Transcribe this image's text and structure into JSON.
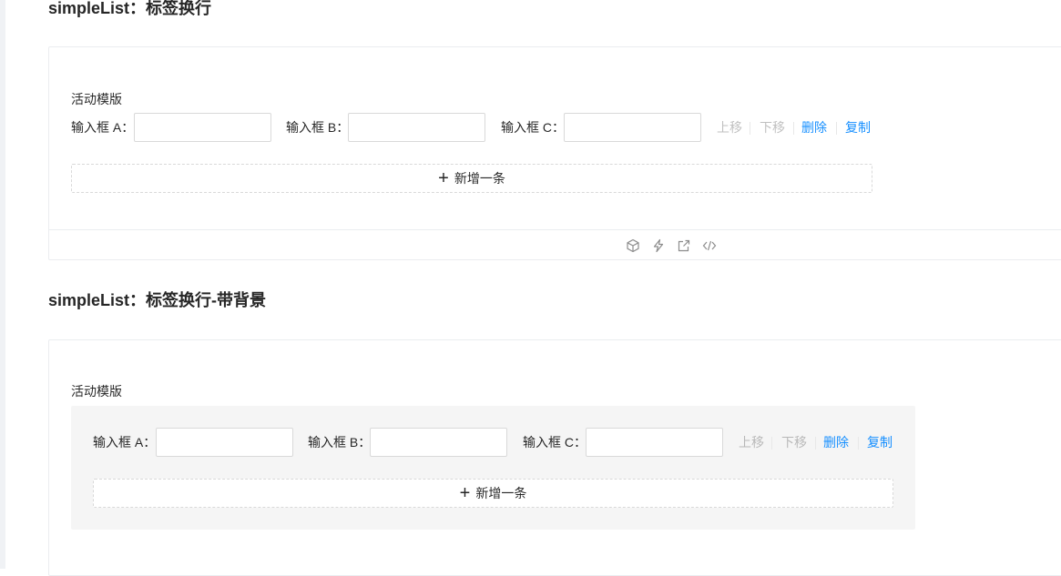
{
  "sections": [
    {
      "title": "simpleList：标签换行",
      "form_label": "活动模版",
      "fields": [
        {
          "label": "输入框 A：",
          "value": ""
        },
        {
          "label": "输入框 B：",
          "value": ""
        },
        {
          "label": "输入框 C：",
          "value": ""
        }
      ],
      "actions": {
        "up": "上移",
        "down": "下移",
        "delete": "删除",
        "copy": "复制"
      },
      "add_label": "新增一条",
      "footer_icons": [
        "codesandbox-icon",
        "thunderbolt-icon",
        "open-external-icon",
        "code-icon"
      ]
    },
    {
      "title": "simpleList：标签换行-带背景",
      "form_label": "活动模版",
      "fields": [
        {
          "label": "输入框 A：",
          "value": ""
        },
        {
          "label": "输入框 B：",
          "value": ""
        },
        {
          "label": "输入框 C：",
          "value": ""
        }
      ],
      "actions": {
        "up": "上移",
        "down": "下移",
        "delete": "删除",
        "copy": "复制"
      },
      "add_label": "新增一条"
    }
  ],
  "colors": {
    "link": "#1890ff",
    "disabled": "rgba(0,0,0,0.25)",
    "border": "#d9d9d9",
    "background_box": "#f5f5f5"
  }
}
